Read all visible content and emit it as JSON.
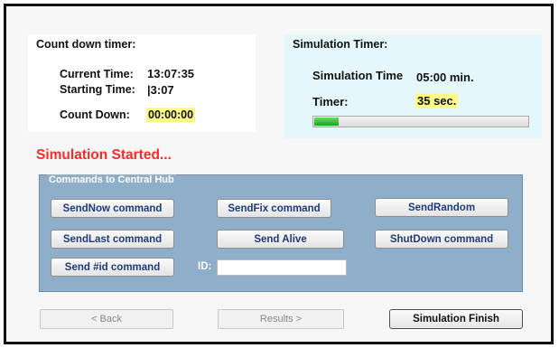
{
  "countdown": {
    "title": "Count down timer:",
    "current_time_label": "Current Time:",
    "current_time_value": "13:07:35",
    "starting_time_label": "Starting Time:",
    "starting_time_value": "|3:07",
    "count_down_label": "Count Down:",
    "count_down_value": "00:00:00"
  },
  "simulation_timer": {
    "title": "Simulation Timer:",
    "simulation_time_label": "Simulation Time",
    "simulation_time_value": "05:00 min.",
    "timer_label": "Timer:",
    "timer_value": "35 sec.",
    "progress_percent": 12
  },
  "status_text": "Simulation Started...",
  "commands": {
    "group_title": "Commands to Central Hub",
    "send_now": "SendNow command",
    "send_fix": "SendFix command",
    "send_random": "SendRandom",
    "send_last": "SendLast command",
    "send_alive": "Send Alive",
    "shutdown": "ShutDown command",
    "send_id": "Send #id command",
    "id_label": "ID:",
    "id_value": ""
  },
  "navigation": {
    "back": "< Back",
    "results": "Results >",
    "finish": "Simulation Finish"
  },
  "colors": {
    "status_red": "#ff2a2a",
    "highlight_yellow": "#fcfc87",
    "sim_panel_bg": "#e5f7fb",
    "group_bg": "#8faec9",
    "progress_green": "#19a519"
  }
}
